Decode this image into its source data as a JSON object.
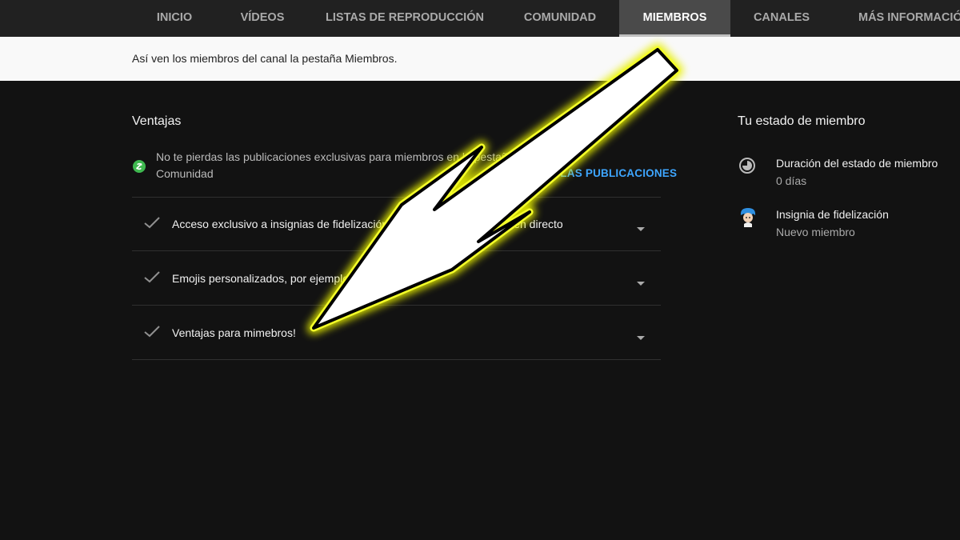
{
  "nav": {
    "tabs": [
      {
        "label": "INICIO"
      },
      {
        "label": "VÍDEOS"
      },
      {
        "label": "LISTAS DE REPRODUCCIÓN"
      },
      {
        "label": "COMUNIDAD"
      },
      {
        "label": "MIEMBROS",
        "active": true
      },
      {
        "label": "CANALES"
      },
      {
        "label": "MÁS INFORMACIÓN"
      }
    ]
  },
  "banner": {
    "text": "Así ven los miembros del canal la pestaña Miembros."
  },
  "perks": {
    "heading": "Ventajas",
    "community_perk": {
      "text": "No te pierdas las publicaciones exclusivas para miembros en la pestaña Comunidad",
      "link_label": "VER LAS PUBLICACIONES"
    },
    "items": [
      {
        "label": "Acceso exclusivo a insignias de fidelización para comentarios y chat en directo"
      },
      {
        "label": "Emojis personalizados, por ejemplo"
      },
      {
        "label": "Ventajas para mimebros!"
      }
    ]
  },
  "status": {
    "heading": "Tu estado de miembro",
    "items": [
      {
        "title": "Duración del estado de miembro",
        "value": "0 días",
        "icon": "clock-progress-icon"
      },
      {
        "title": "Insignia de fidelización",
        "value": "Nuevo miembro",
        "icon": "badge-avatar-icon"
      }
    ]
  },
  "colors": {
    "background": "#121212",
    "tab_bar": "#212121",
    "active_tab": "#4a4a4a",
    "link": "#3ea6ff",
    "perk_icon": "#3fb950",
    "arrow_glow": "#e8f000"
  }
}
